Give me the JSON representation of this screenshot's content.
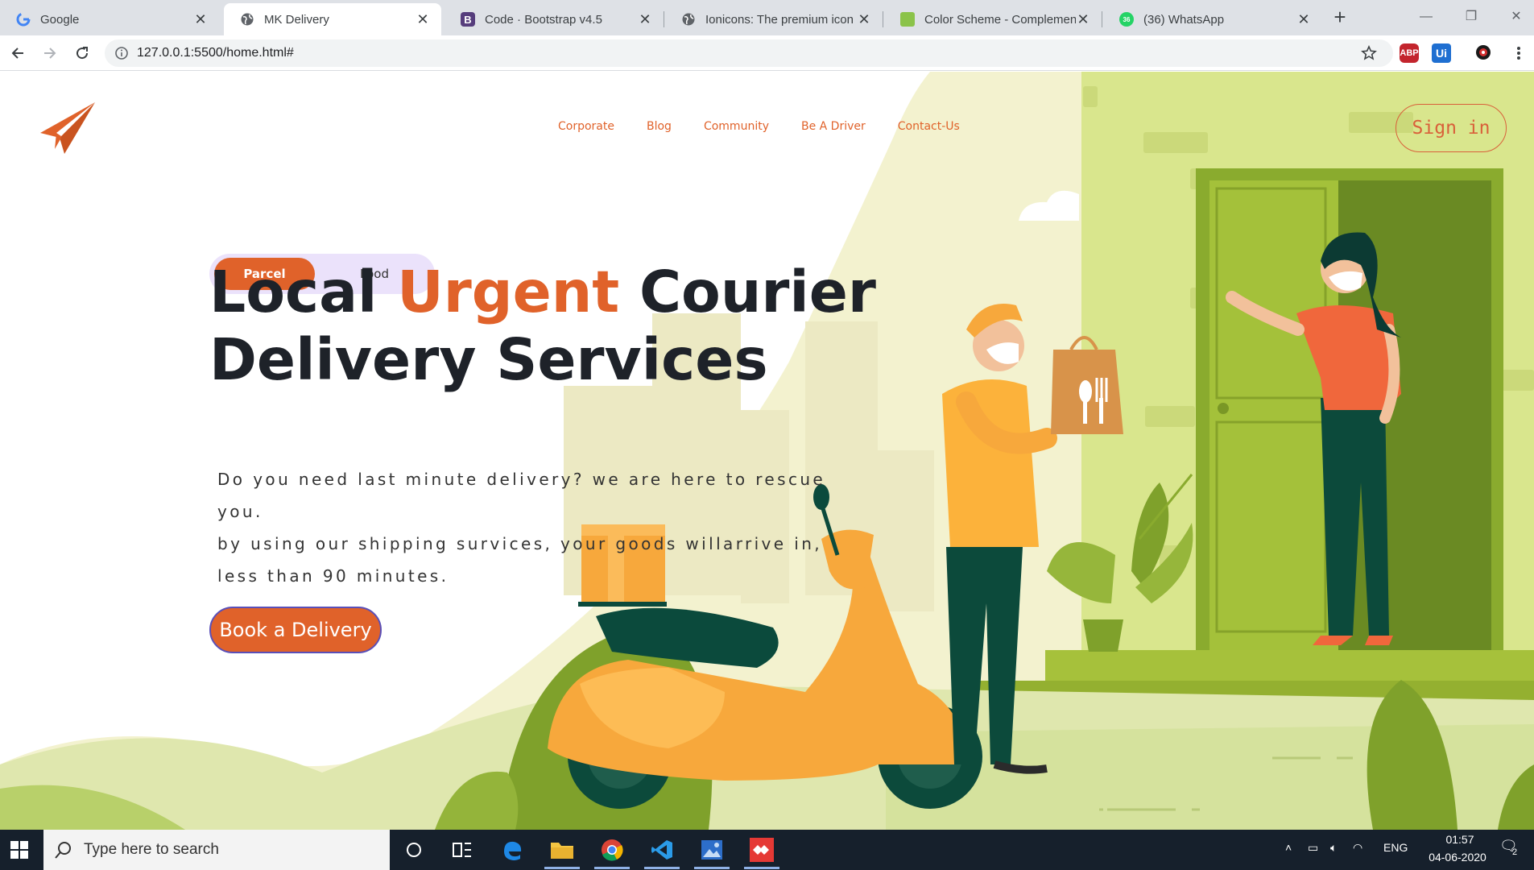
{
  "browser": {
    "tabs": [
      {
        "title": "Google",
        "icon": "google-icon"
      },
      {
        "title": "MK Delivery",
        "icon": "globe-icon",
        "active": true
      },
      {
        "title": "Code · Bootstrap v4.5",
        "icon": "bootstrap-icon"
      },
      {
        "title": "Ionicons: The premium icon",
        "icon": "globe-icon"
      },
      {
        "title": "Color Scheme - Complement",
        "icon": "color-scheme-icon"
      },
      {
        "title": "(36) WhatsApp",
        "icon": "whatsapp-icon"
      }
    ],
    "url": "127.0.0.1:5500/home.html#",
    "extensions": [
      {
        "label": "ABP",
        "color": "#c3252d"
      },
      {
        "label": "Ui",
        "color": "#1f6fd1"
      }
    ]
  },
  "site": {
    "nav": [
      "Corporate",
      "Blog",
      "Community",
      "Be A Driver",
      "Contact-Us"
    ],
    "signin_label": "Sign in",
    "toggle": {
      "parcel": "Parcel",
      "food": "Food"
    },
    "headline": {
      "part1": "Local",
      "highlight": "Urgent",
      "part2": "Courier",
      "line2": "Delivery Services"
    },
    "description": [
      "Do you need last minute delivery? we are here to rescue you.",
      "by using our shipping survices, your goods willarrive in,",
      "less than 90 minutes."
    ],
    "cta_label": "Book a Delivery",
    "colors": {
      "accent": "#e0622a",
      "dark_text": "#1e2229",
      "toggle_bg": "#ebe2fb"
    }
  },
  "taskbar": {
    "search_placeholder": "Type here to search",
    "language": "ENG",
    "time": "01:57",
    "date": "04-06-2020",
    "notification_count": "2"
  }
}
